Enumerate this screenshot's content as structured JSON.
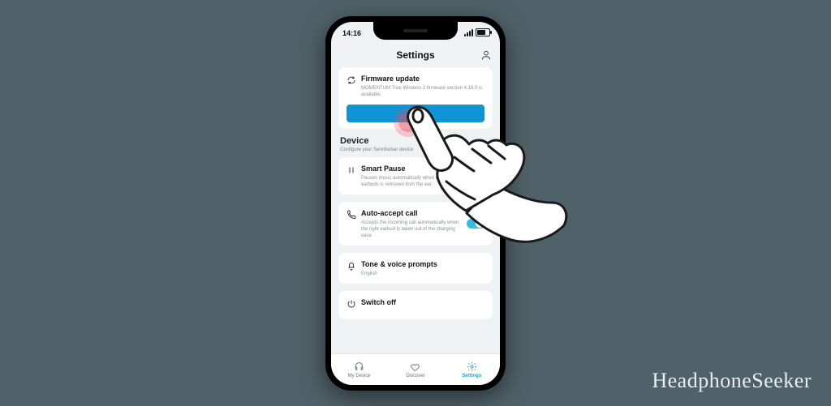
{
  "statusbar": {
    "time": "14:16"
  },
  "header": {
    "title": "Settings"
  },
  "firmware": {
    "title": "Firmware update",
    "subtitle": "MOMENTUM True Wireless 2 firmware version 4.16.0 is available."
  },
  "device_section": {
    "title": "Device",
    "subtitle": "Configure your Sennheiser device"
  },
  "smart_pause": {
    "title": "Smart Pause",
    "subtitle": "Pauses music automatically when one of the earbuds is removed from the ear."
  },
  "auto_accept": {
    "title": "Auto-accept call",
    "subtitle": "Accepts the incoming call automatically when the right earbud is taken out of the charging case."
  },
  "tone": {
    "title": "Tone & voice prompts",
    "subtitle": "English"
  },
  "switch_off": {
    "title": "Switch off"
  },
  "tabs": {
    "my_device": "My Device",
    "discover": "Discover",
    "settings": "Settings"
  },
  "watermark": "HeadphoneSeeker"
}
